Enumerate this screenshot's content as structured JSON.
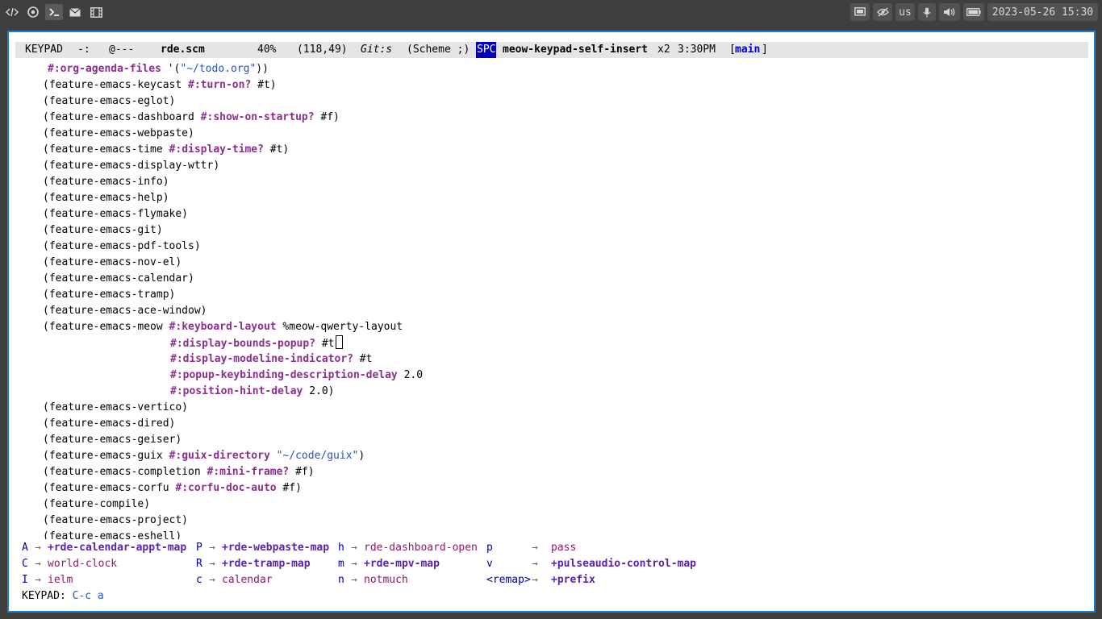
{
  "topbar": {
    "left_icons": [
      "code-icon",
      "chrome-icon",
      "terminal-icon",
      "mail-icon",
      "film-icon"
    ],
    "tray": {
      "layout": "us",
      "datetime": "2023-05-26 15:30"
    }
  },
  "modeline": {
    "state": "KEYPAD",
    "flags": "-:",
    "at": "@---",
    "buffer": "rde.scm",
    "percent": "40%",
    "position": "(118,49)",
    "vc": "Git:s",
    "mode": "(Scheme ;)",
    "key": "SPC",
    "command": "meow-keypad-self-insert",
    "count": "x2",
    "time": "3:30PM",
    "branch_open": "[",
    "branch": "main",
    "branch_close": "]"
  },
  "code": {
    "lines": [
      {
        "pre": "",
        "kw": "#:org-agenda-files",
        "mid": " '(",
        "str": "\"~/todo.org\"",
        "post": "))"
      },
      {
        "pre": "(feature-emacs-keycast ",
        "kw": "#:turn-on?",
        "post": " #t)"
      },
      {
        "pre": "(feature-emacs-eglot)"
      },
      {
        "pre": "(feature-emacs-dashboard ",
        "kw": "#:show-on-startup?",
        "post": " #f)"
      },
      {
        "pre": "(feature-emacs-webpaste)"
      },
      {
        "pre": "(feature-emacs-time ",
        "kw": "#:display-time?",
        "post": " #t)"
      },
      {
        "pre": "(feature-emacs-display-wttr)"
      },
      {
        "pre": "(feature-emacs-info)"
      },
      {
        "pre": "(feature-emacs-help)"
      },
      {
        "pre": "(feature-emacs-flymake)"
      },
      {
        "pre": "(feature-emacs-git)"
      },
      {
        "pre": "(feature-emacs-pdf-tools)"
      },
      {
        "pre": "(feature-emacs-nov-el)"
      },
      {
        "pre": "(feature-emacs-calendar)"
      },
      {
        "pre": "(feature-emacs-tramp)"
      },
      {
        "pre": "(feature-emacs-ace-window)"
      },
      {
        "pre": "(feature-emacs-meow ",
        "kw": "#:keyboard-layout",
        "post": " %meow-qwerty-layout"
      },
      {
        "pre": "",
        "kw": "#:display-bounds-popup?",
        "post": " #t"
      },
      {
        "pre": "",
        "kw": "#:display-modeline-indicator?",
        "post": " #t"
      },
      {
        "pre": "",
        "kw": "#:popup-keybinding-description-delay",
        "post": " 2.0"
      },
      {
        "pre": "",
        "kw": "#:position-hint-delay",
        "post": " 2.0)"
      },
      {
        "pre": "(feature-emacs-vertico)"
      },
      {
        "pre": "(feature-emacs-dired)"
      },
      {
        "pre": "(feature-emacs-geiser)"
      },
      {
        "pre": "(feature-emacs-guix ",
        "kw": "#:guix-directory",
        "mid": " ",
        "str": "\"~/code/guix\"",
        "post": ")"
      },
      {
        "pre": "(feature-emacs-completion ",
        "kw": "#:mini-frame?",
        "post": " #f)"
      },
      {
        "pre": "(feature-emacs-corfu ",
        "kw": "#:corfu-doc-auto",
        "post": " #f)"
      },
      {
        "pre": "(feature-compile)"
      },
      {
        "pre": "(feature-emacs-project)"
      },
      {
        "pre": "(feature-emacs-eshell)"
      }
    ]
  },
  "which_key": {
    "arrow": "→",
    "entries": [
      {
        "key": "A",
        "cmd": "+rde-calendar-appt-map",
        "prefix": true
      },
      {
        "key": "P",
        "cmd": "+rde-webpaste-map",
        "prefix": true
      },
      {
        "key": "h",
        "cmd": "rde-dashboard-open",
        "prefix": false
      },
      {
        "key": "p",
        "cmd": "pass",
        "prefix": false
      },
      {
        "key": "C",
        "cmd": "world-clock",
        "prefix": false
      },
      {
        "key": "R",
        "cmd": "+rde-tramp-map",
        "prefix": true
      },
      {
        "key": "m",
        "cmd": "+rde-mpv-map",
        "prefix": true
      },
      {
        "key": "v",
        "cmd": "+pulseaudio-control-map",
        "prefix": true
      },
      {
        "key": "I",
        "cmd": "ielm",
        "prefix": false
      },
      {
        "key": "c",
        "cmd": "calendar",
        "prefix": false
      },
      {
        "key": "n",
        "cmd": "notmuch",
        "prefix": false
      },
      {
        "key": "<remap>",
        "cmd": "+prefix",
        "prefix": true
      }
    ]
  },
  "echo": {
    "label": "KEYPAD: ",
    "keys": "C-c a"
  },
  "colors": {
    "frame_border": "#1d7fd1",
    "keyword": "#8b2f8f",
    "string": "#2a52be",
    "spc_badge": "#0000c0"
  }
}
